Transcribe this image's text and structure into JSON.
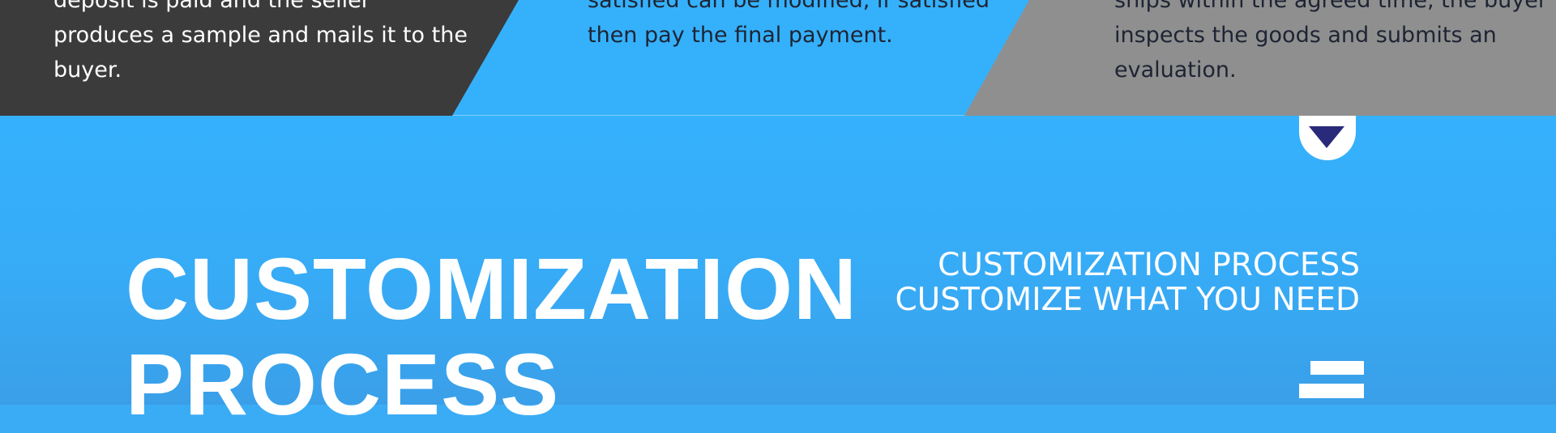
{
  "steps": [
    {
      "text": "deposit is paid and the seller produces a sample and mails it to the buyer."
    },
    {
      "text": "satisfied can be modified, if satisfied then pay the final payment."
    },
    {
      "text": "ships within the agreed time, the buyer inspects the goods and submits an evaluation."
    }
  ],
  "hero": {
    "title_line1": "CUSTOMIZATION",
    "title_line2": "PROCESS",
    "subtitle_line1": "CUSTOMIZATION PROCESS",
    "subtitle_line2": "CUSTOMIZE WHAT YOU NEED"
  },
  "icons": {
    "notch": "chevron-down-icon",
    "menu": "menu-icon"
  },
  "colors": {
    "background_blue": "#35b1fc",
    "panel_dark": "#3b3b3b",
    "panel_gray": "#8f8f8f",
    "arrow": "#2a2a7a",
    "text_light": "#ffffff",
    "text_dark": "#1e2433"
  }
}
